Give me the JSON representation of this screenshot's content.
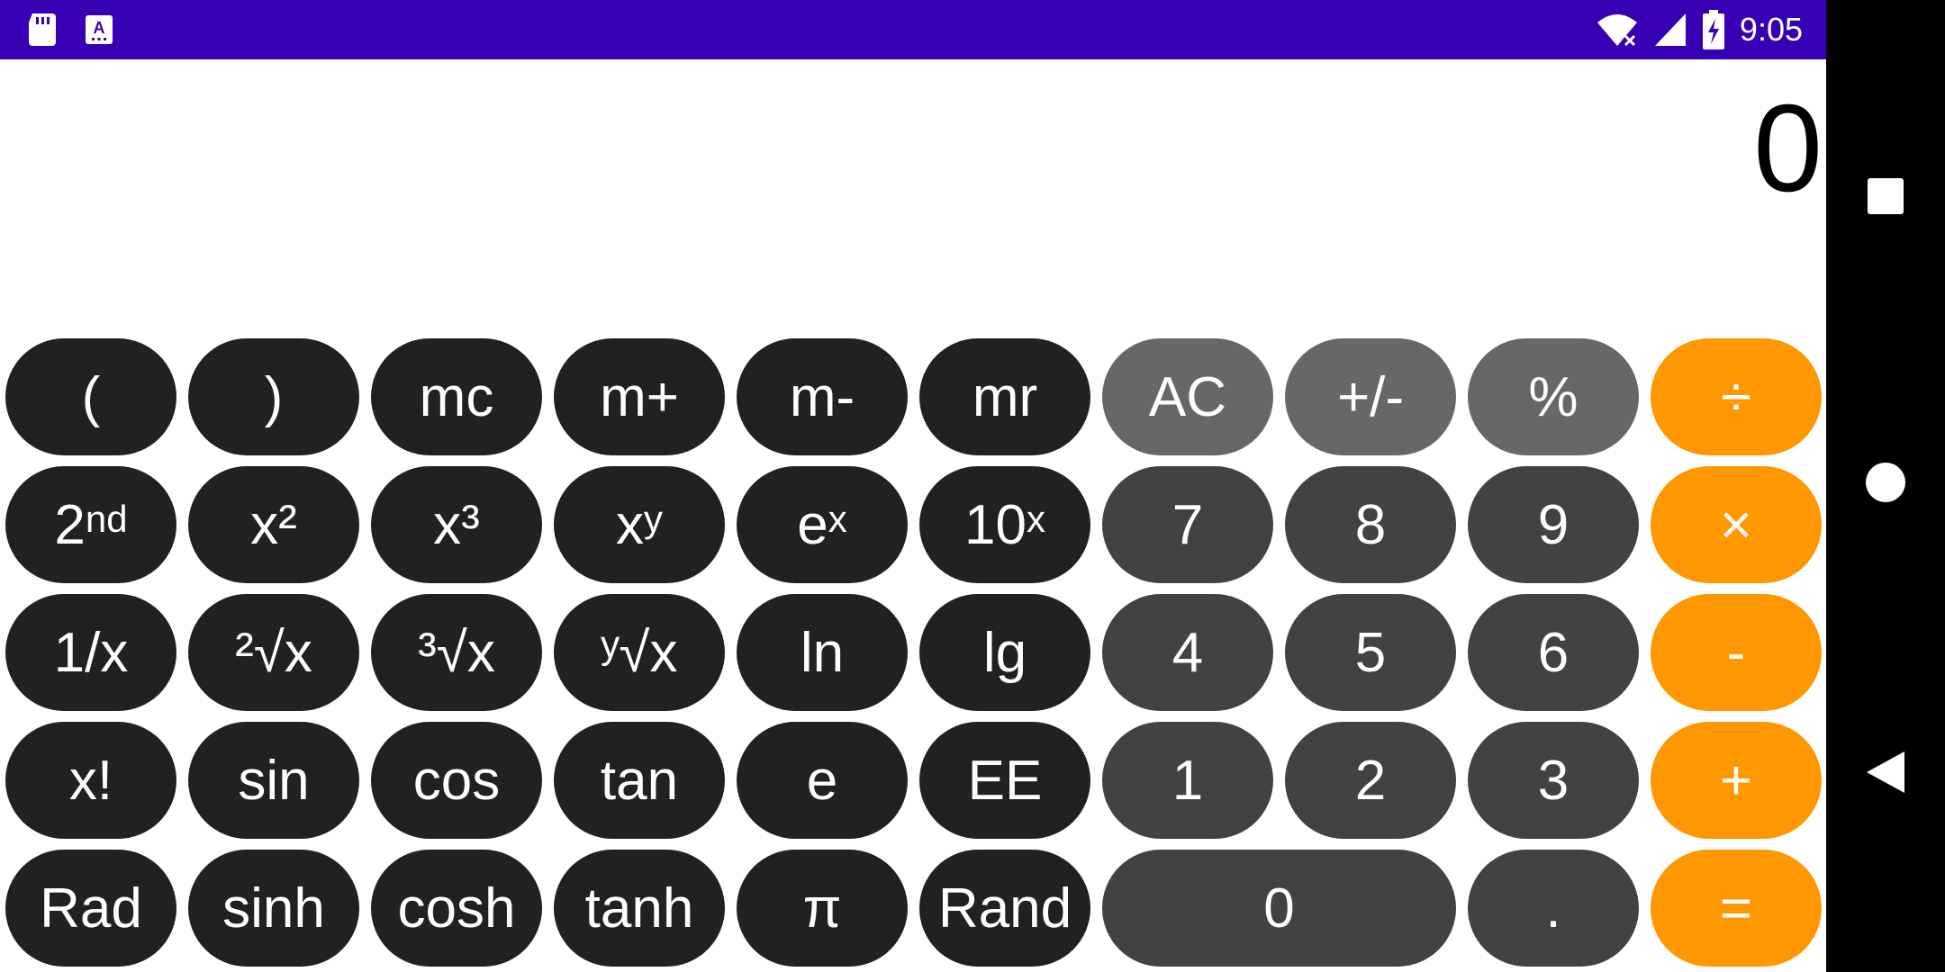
{
  "status_bar": {
    "time": "9:05",
    "left_icons": [
      "sd-card-icon",
      "keyboard-a-icon"
    ],
    "right_icons": [
      "wifi-off-icon",
      "cell-signal-icon",
      "battery-charging-icon"
    ],
    "background_color": "#3700b3"
  },
  "display": {
    "value": "0"
  },
  "keys": {
    "open_paren": "(",
    "close_paren": ")",
    "mc": "mc",
    "m_plus": "m+",
    "m_minus": "m-",
    "mr": "mr",
    "ac": "AC",
    "plus_minus": "+/-",
    "percent": "%",
    "divide": "÷",
    "second_base": "2",
    "second_sup": "nd",
    "x_squared": "x²",
    "x_cubed": "x³",
    "x_pow_y_base": "x",
    "x_pow_y_sup": "y",
    "e_pow_x_base": "e",
    "e_pow_x_sup": "x",
    "ten_pow_x_base": "10",
    "ten_pow_x_sup": "x",
    "seven": "7",
    "eight": "8",
    "nine": "9",
    "multiply": "×",
    "reciprocal": "1/x",
    "sqrt2": "²√x",
    "sqrt3": "³√x",
    "sqrty": "ʸ√x",
    "ln": "ln",
    "lg": "lg",
    "four": "4",
    "five": "5",
    "six": "6",
    "minus": "-",
    "factorial": "x!",
    "sin": "sin",
    "cos": "cos",
    "tan": "tan",
    "e": "e",
    "ee": "EE",
    "one": "1",
    "two": "2",
    "three": "3",
    "plus": "+",
    "rad": "Rad",
    "sinh": "sinh",
    "cosh": "cosh",
    "tanh": "tanh",
    "pi": "π",
    "rand": "Rand",
    "zero": "0",
    "decimal": ".",
    "equals": "="
  },
  "colors": {
    "function_key": "#212121",
    "utility_key": "#676767",
    "digit_key": "#424242",
    "operator_key": "#ff9800"
  },
  "nav_bar": {
    "buttons": [
      "recents-square-icon",
      "home-circle-icon",
      "back-triangle-icon"
    ]
  }
}
